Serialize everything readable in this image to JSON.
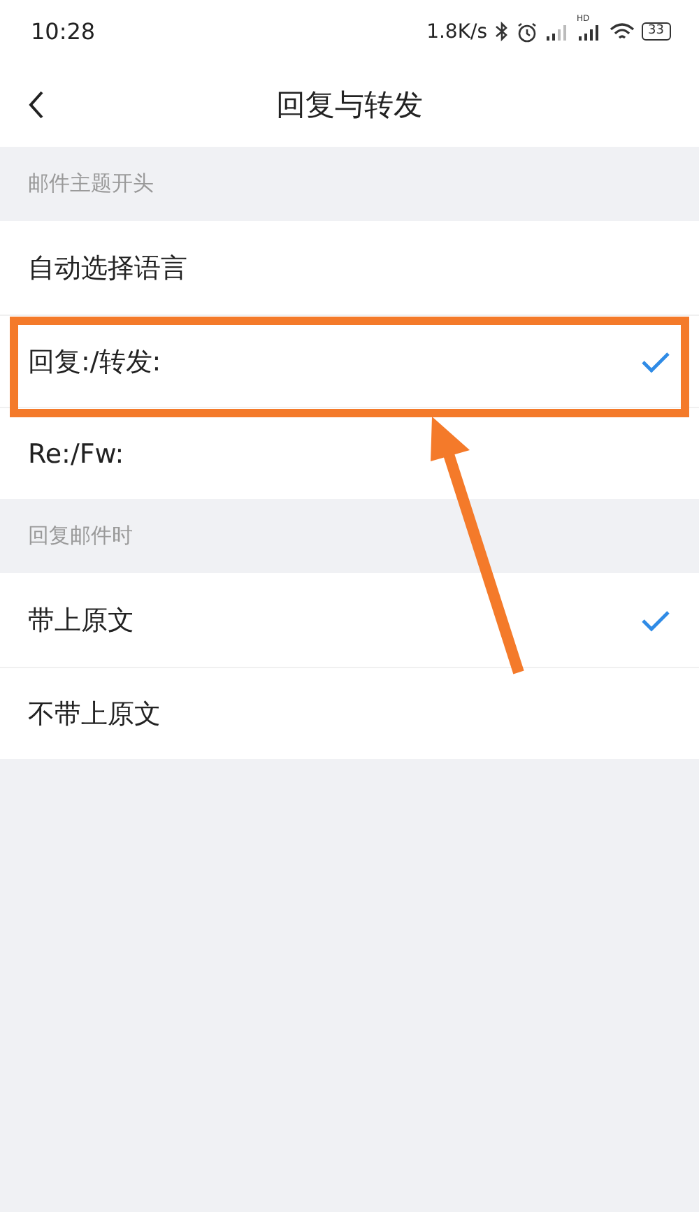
{
  "status_bar": {
    "time": "10:28",
    "net_speed": "1.8K/s",
    "signal_label": "HD",
    "battery": "33"
  },
  "header": {
    "title": "回复与转发"
  },
  "groups": [
    {
      "title": "邮件主题开头",
      "options": [
        {
          "label": "自动选择语言",
          "selected": false
        },
        {
          "label": "回复:/转发:",
          "selected": true
        },
        {
          "label": "Re:/Fw:",
          "selected": false
        }
      ]
    },
    {
      "title": "回复邮件时",
      "options": [
        {
          "label": "带上原文",
          "selected": true
        },
        {
          "label": "不带上原文",
          "selected": false
        }
      ]
    }
  ]
}
